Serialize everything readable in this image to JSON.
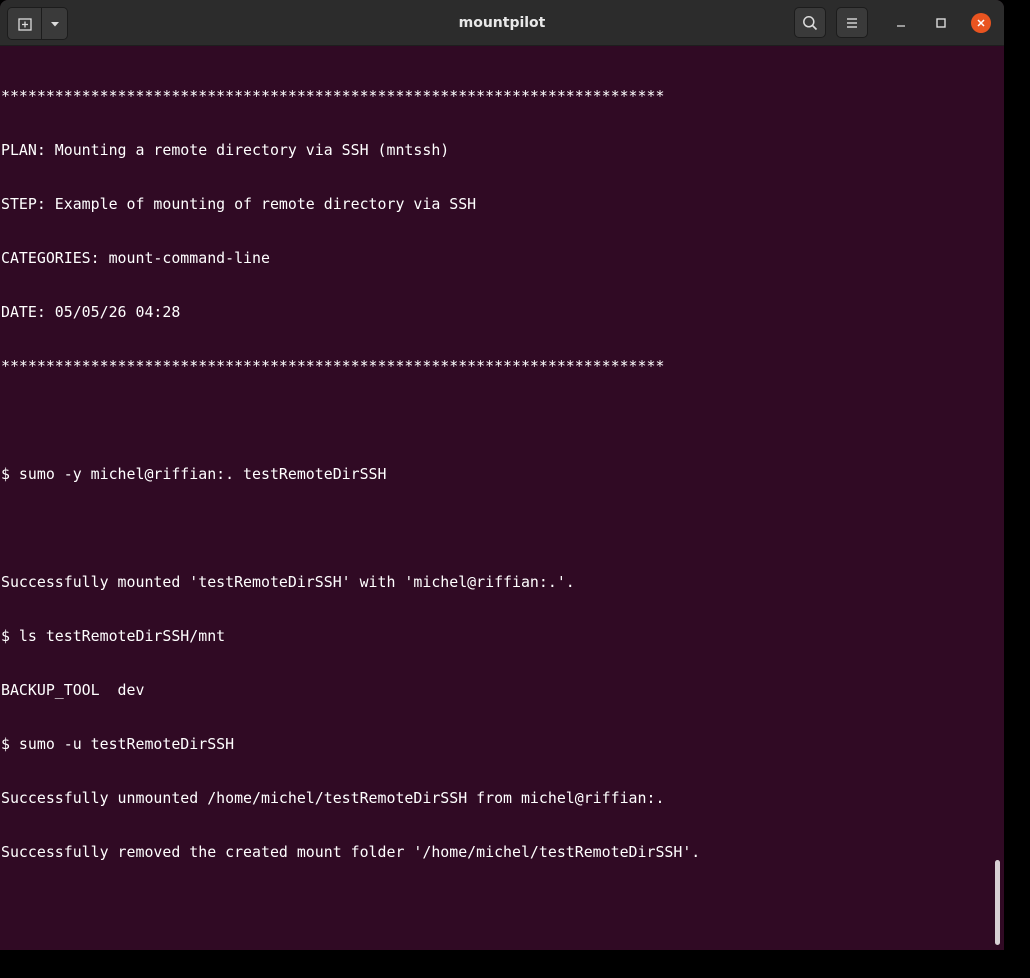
{
  "window": {
    "title": "mountpilot",
    "background": "#300a24",
    "accent": "#e95420"
  },
  "header": {
    "new_tab_icon": "new-tab-icon",
    "dropdown_icon": "chevron-down-icon",
    "search_icon": "search-icon",
    "menu_icon": "hamburger-menu-icon",
    "minimize_icon": "minimize-icon",
    "maximize_icon": "maximize-icon",
    "close_icon": "close-icon"
  },
  "terminal": {
    "lines": [
      "**************************************************************************",
      "PLAN: Mounting a remote directory via SSH (mntssh)",
      "STEP: Example of mounting of remote directory via SSH",
      "CATEGORIES: mount-command-line",
      "DATE: 05/05/26 04:28",
      "**************************************************************************",
      "",
      "$ sumo -y michel@riffian:. testRemoteDirSSH",
      "",
      "Successfully mounted 'testRemoteDirSSH' with 'michel@riffian:.'.",
      "$ ls testRemoteDirSSH/mnt",
      "BACKUP_TOOL  dev",
      "$ sumo -u testRemoteDirSSH",
      "Successfully unmounted /home/michel/testRemoteDirSSH from michel@riffian:.",
      "Successfully removed the created mount folder '/home/michel/testRemoteDirSSH'."
    ]
  }
}
